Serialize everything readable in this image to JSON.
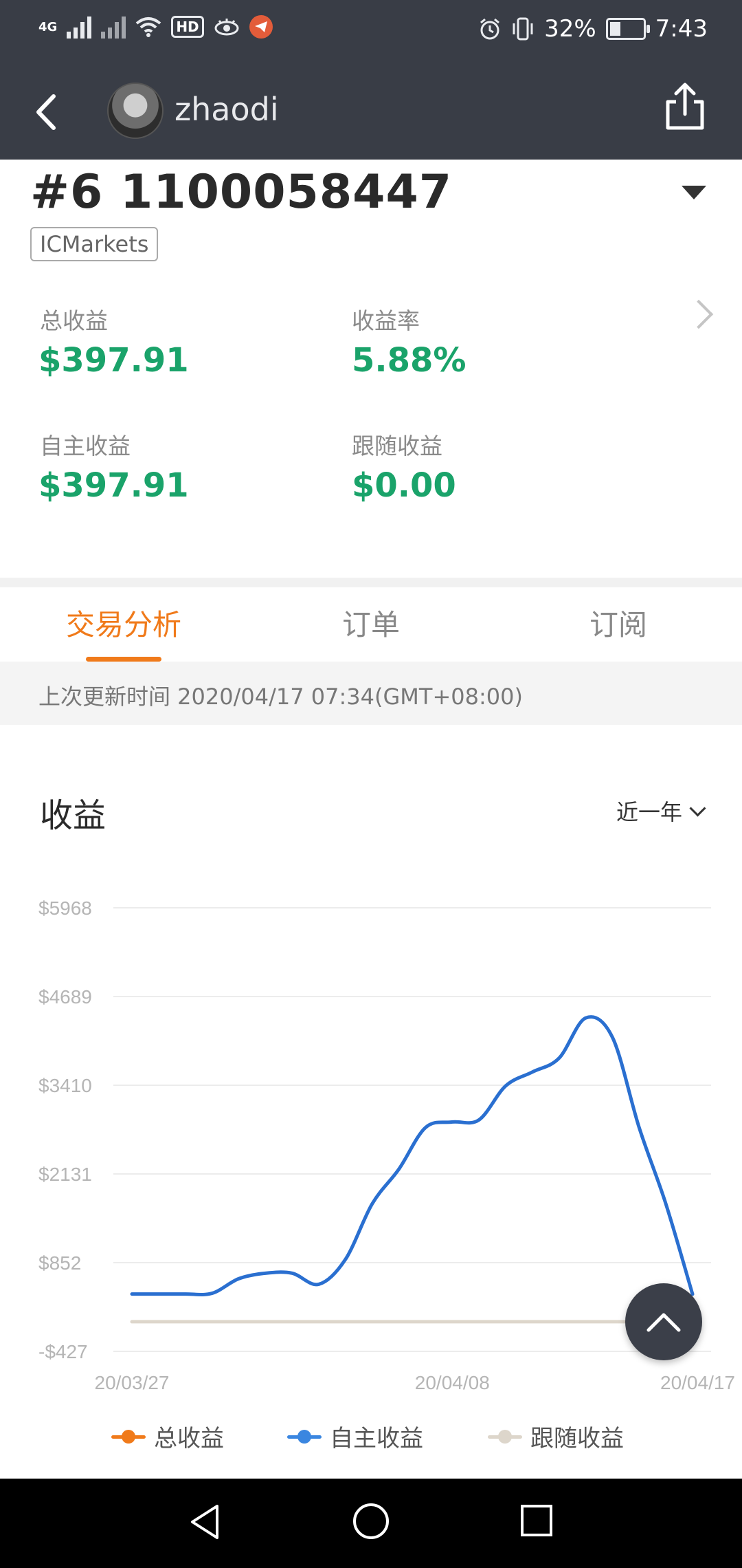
{
  "status_bar": {
    "network": "4G",
    "hd": "HD",
    "battery_text": "32%",
    "battery_level": 0.32,
    "time": "7:43"
  },
  "header": {
    "username": "zhaodi"
  },
  "account": {
    "id": "#6 1100058447",
    "broker": "ICMarkets"
  },
  "stats": {
    "total_label": "总收益",
    "total_value": "$397.91",
    "rate_label": "收益率",
    "rate_value": "5.88%",
    "own_label": "自主收益",
    "own_value": "$397.91",
    "follow_label": "跟随收益",
    "follow_value": "$0.00"
  },
  "tabs": [
    {
      "label": "交易分析",
      "active": true
    },
    {
      "label": "订单",
      "active": false
    },
    {
      "label": "订阅",
      "active": false
    }
  ],
  "last_updated": "上次更新时间 2020/04/17 07:34(GMT+08:00)",
  "section": {
    "title": "收益",
    "period": "近一年"
  },
  "colors": {
    "accent": "#f07a1a",
    "positive": "#1aa36a",
    "line_own": "#2a6fd0",
    "line_follow": "#ddd6cb",
    "line_total": "#f07a1a",
    "header_bg": "#393d46"
  },
  "chart_data": {
    "type": "line",
    "x_ticks": [
      "20/03/27",
      "20/04/08",
      "20/04/17"
    ],
    "y_ticks": [
      "$5968",
      "$4689",
      "$3410",
      "$2131",
      "$852",
      "-$427"
    ],
    "ylim": [
      -427,
      5968
    ],
    "x_range": [
      "2020-03-27",
      "2020-04-17"
    ],
    "grid": true,
    "series": [
      {
        "name": "自主收益",
        "color_key": "line_own",
        "points": [
          [
            "2020-03-27",
            400
          ],
          [
            "2020-03-28",
            400
          ],
          [
            "2020-03-29",
            400
          ],
          [
            "2020-03-30",
            410
          ],
          [
            "2020-03-31",
            620
          ],
          [
            "2020-04-01",
            700
          ],
          [
            "2020-04-02",
            700
          ],
          [
            "2020-04-03",
            540
          ],
          [
            "2020-04-04",
            900
          ],
          [
            "2020-04-05",
            1700
          ],
          [
            "2020-04-06",
            2200
          ],
          [
            "2020-04-07",
            2800
          ],
          [
            "2020-04-08",
            2880
          ],
          [
            "2020-04-09",
            2910
          ],
          [
            "2020-04-10",
            3400
          ],
          [
            "2020-04-11",
            3600
          ],
          [
            "2020-04-12",
            3800
          ],
          [
            "2020-04-13",
            4380
          ],
          [
            "2020-04-14",
            4100
          ],
          [
            "2020-04-15",
            2800
          ],
          [
            "2020-04-16",
            1700
          ],
          [
            "2020-04-17",
            398
          ]
        ]
      },
      {
        "name": "跟随收益",
        "color_key": "line_follow",
        "points": [
          [
            "2020-03-27",
            0
          ],
          [
            "2020-04-17",
            0
          ]
        ]
      }
    ],
    "legend": [
      {
        "name": "总收益",
        "color_key": "line_total"
      },
      {
        "name": "自主收益",
        "color_key": "line_own"
      },
      {
        "name": "跟随收益",
        "color_key": "line_follow"
      }
    ]
  }
}
